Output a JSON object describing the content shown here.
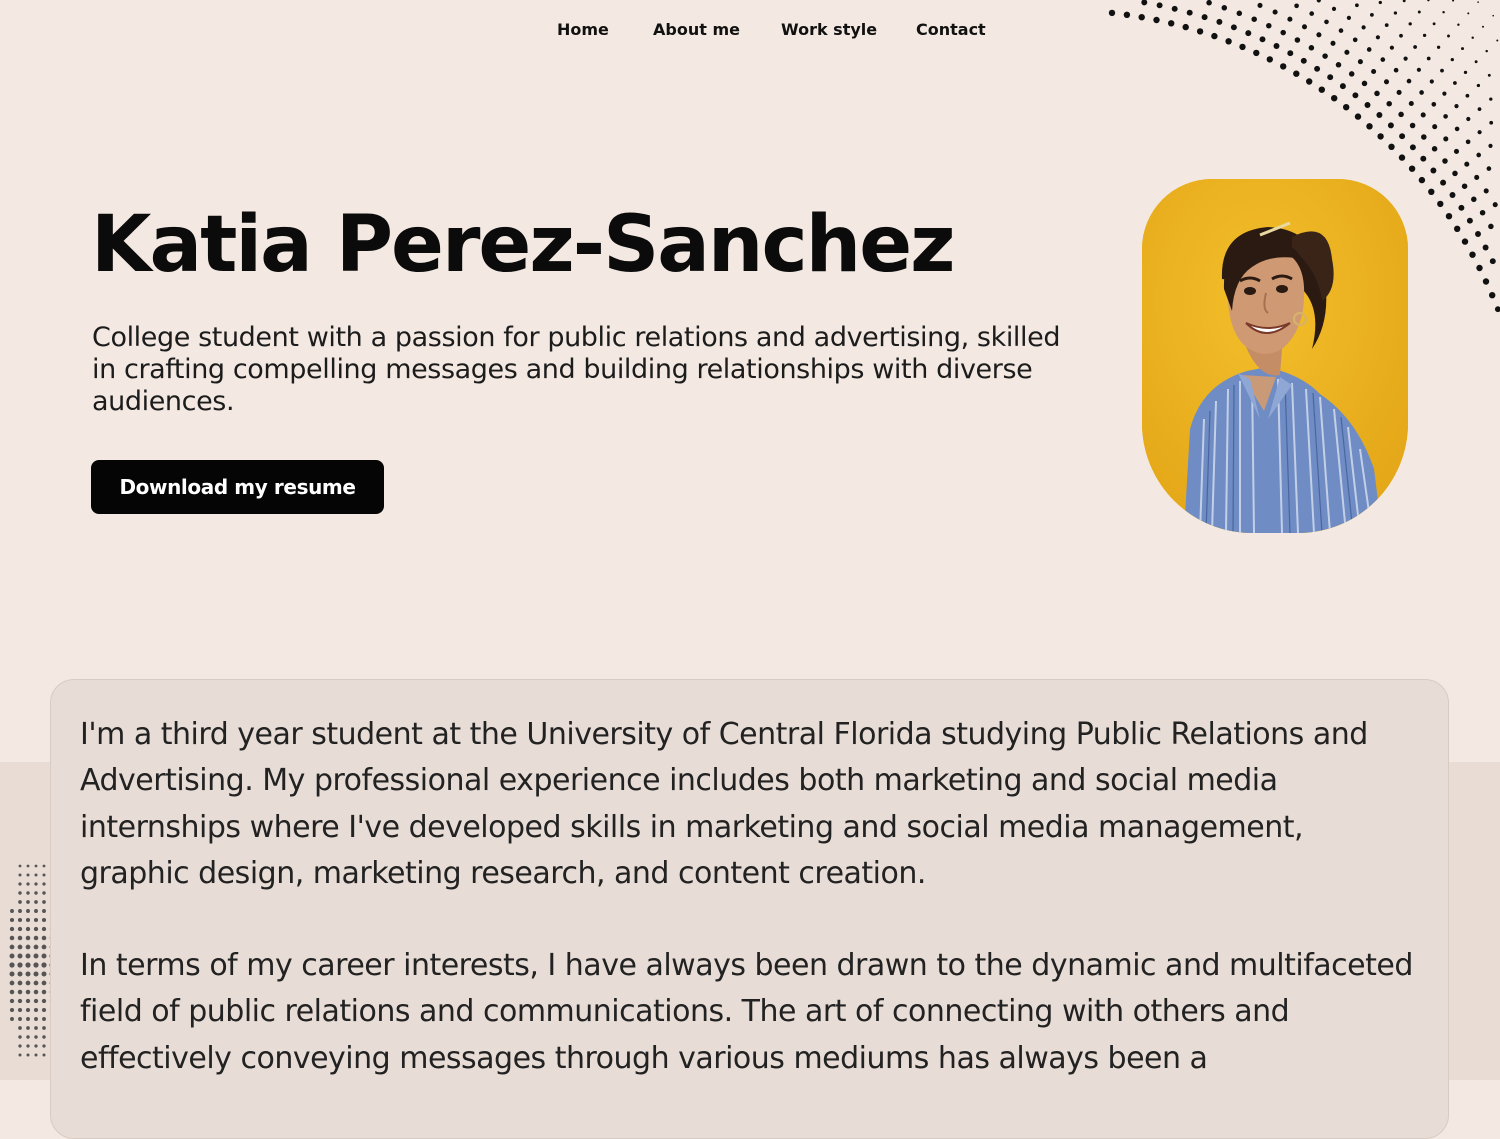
{
  "nav": {
    "items": [
      {
        "label": "Home"
      },
      {
        "label": "About me"
      },
      {
        "label": "Work style"
      },
      {
        "label": "Contact"
      }
    ]
  },
  "hero": {
    "name": "Katia Perez-Sanchez",
    "tagline": "College student with a passion for public relations and advertising, skilled in crafting compelling messages and building relationships with diverse audiences.",
    "resume_button": "Download my resume"
  },
  "about": {
    "paragraphs": [
      "I'm a third year student at the University of Central Florida studying Public Relations and Advertising. My professional experience includes both marketing and social media internships where I've developed skills in marketing and social media management, graphic design, marketing research, and content creation.",
      "In terms of my career interests, I have always been drawn to the dynamic and multifaceted field of public relations and communications. The art of connecting with others and effectively conveying messages through various mediums has always been a"
    ]
  },
  "colors": {
    "background": "#f3e9e2",
    "lower_band": "#e9dcd5",
    "card": "#e8ddd6",
    "photo_backdrop": "#efb420",
    "button": "#050505"
  }
}
